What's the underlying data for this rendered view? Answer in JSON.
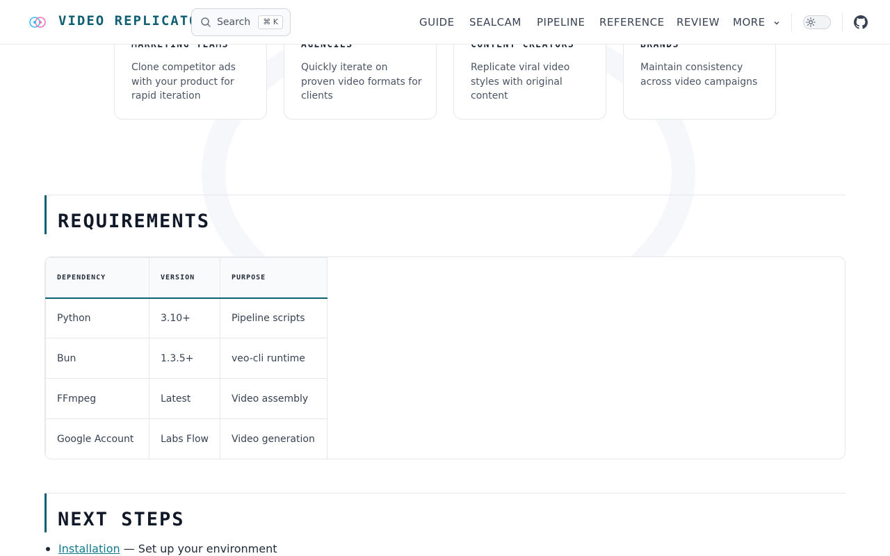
{
  "brand": {
    "name": "VIDEO REPLICATOR",
    "icon": "brain-icon"
  },
  "search": {
    "label": "Search",
    "shortcut": "⌘ K"
  },
  "nav": [
    {
      "label": "GUIDE"
    },
    {
      "label": "SEALCAM"
    },
    {
      "label": "PIPELINE"
    },
    {
      "label": "REFERENCE"
    },
    {
      "label": "REVIEW"
    },
    {
      "label": "MORE"
    }
  ],
  "theme_toggle": {
    "state": "light",
    "icon": "sun-icon"
  },
  "github": {
    "icon": "github-icon"
  },
  "cards": [
    {
      "title": "MARKETING TEAMS",
      "text": "Clone competitor ads with your product for rapid iteration"
    },
    {
      "title": "AGENCIES",
      "text": "Quickly iterate on proven video formats for clients"
    },
    {
      "title": "CONTENT CREATORS",
      "text": "Replicate viral video styles with original content"
    },
    {
      "title": "BRANDS",
      "text": "Maintain consistency across video campaigns"
    }
  ],
  "requirements": {
    "title": "REQUIREMENTS",
    "headers": [
      "DEPENDENCY",
      "VERSION",
      "PURPOSE"
    ],
    "rows": [
      [
        "Python",
        "3.10+",
        "Pipeline scripts"
      ],
      [
        "Bun",
        "1.3.5+",
        "veo-cli runtime"
      ],
      [
        "FFmpeg",
        "Latest",
        "Video assembly"
      ],
      [
        "Google Account",
        "Labs Flow",
        "Video generation"
      ]
    ]
  },
  "next_steps": {
    "title": "NEXT STEPS",
    "items": [
      {
        "link": "Installation",
        "text": " — Set up your environment"
      }
    ]
  },
  "colors": {
    "accent": "#0f5f73",
    "link": "#0f7a8c",
    "border": "#e5e7eb"
  }
}
